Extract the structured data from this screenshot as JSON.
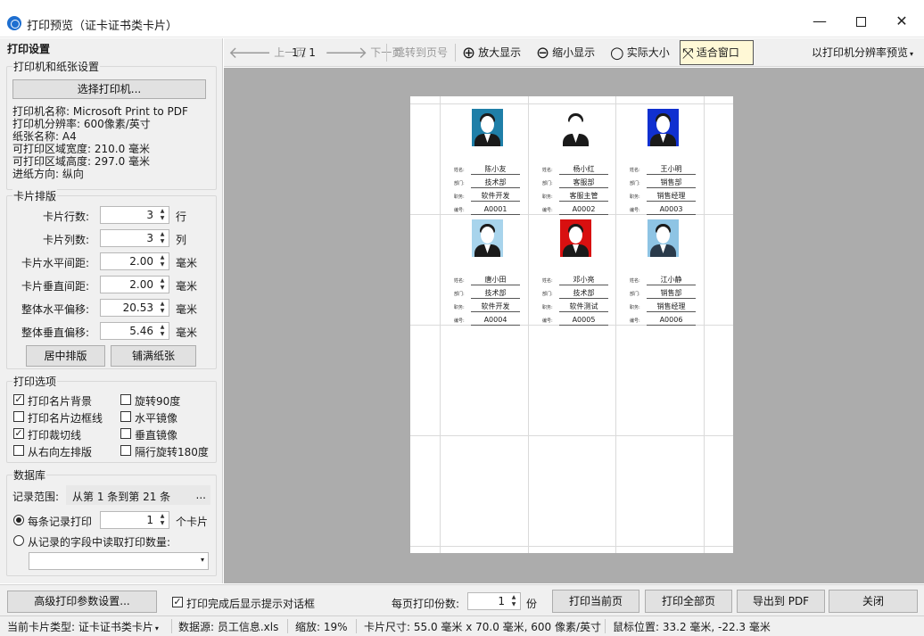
{
  "window": {
    "title": "打印预览（证卡证书类卡片）",
    "min_label": "—",
    "close_label": "✕"
  },
  "left_panel": {
    "title": "打印设置",
    "printer_group": {
      "title": "打印机和纸张设置",
      "select_printer_label": "选择打印机...",
      "lines": [
        "打印机名称: Microsoft Print to PDF",
        "打印机分辨率: 600像素/英寸",
        "纸张名称: A4",
        "可打印区域宽度: 210.0 毫米",
        "可打印区域高度: 297.0 毫米",
        "进纸方向: 纵向"
      ]
    },
    "layout_group": {
      "title": "卡片排版",
      "fields": [
        {
          "label": "卡片行数:",
          "value": "3",
          "unit": "行"
        },
        {
          "label": "卡片列数:",
          "value": "3",
          "unit": "列"
        },
        {
          "label": "卡片水平间距:",
          "value": "2.00",
          "unit": "毫米"
        },
        {
          "label": "卡片垂直间距:",
          "value": "2.00",
          "unit": "毫米"
        },
        {
          "label": "整体水平偏移:",
          "value": "20.53",
          "unit": "毫米"
        },
        {
          "label": "整体垂直偏移:",
          "value": "5.46",
          "unit": "毫米"
        }
      ],
      "center_label": "居中排版",
      "fill_label": "铺满纸张"
    },
    "options_group": {
      "title": "打印选项",
      "checkboxes": [
        {
          "label": "打印名片背景",
          "checked": true
        },
        {
          "label": "打印名片边框线",
          "checked": false
        },
        {
          "label": "打印裁切线",
          "checked": true
        },
        {
          "label": "从右向左排版",
          "checked": false
        },
        {
          "label": "旋转90度",
          "checked": false
        },
        {
          "label": "水平镜像",
          "checked": false
        },
        {
          "label": "垂直镜像",
          "checked": false
        },
        {
          "label": "隔行旋转180度",
          "checked": false
        }
      ],
      "check_mark": "✓"
    },
    "db_group": {
      "title": "数据库",
      "range_label": "记录范围:",
      "range_value": "从第 1 条到第 21 条",
      "range_button": "...",
      "per_record_label": "每条记录打印",
      "per_record_value": "1",
      "per_record_unit": "个卡片",
      "from_field_label": "从记录的字段中读取打印数量:",
      "field_select_value": ""
    }
  },
  "toolbar": {
    "prev_icon": "arrow-left-icon",
    "prev_label": "上一页",
    "page_indicator": "1 / 1",
    "next_icon": "arrow-right-icon",
    "next_label": "下一页",
    "jump_label": "跳转到页号",
    "zoom_in_label": "放大显示",
    "zoom_out_label": "缩小显示",
    "actual_label": "实际大小",
    "fit_label": "适合窗口",
    "resolution_label": "以打印机分辨率预览",
    "glyph_prev": "🡐",
    "glyph_next": "🡒",
    "glyph_zoom_in": "⊕",
    "glyph_zoom_out": "⊖",
    "glyph_actual": "○",
    "glyph_fit": "⤧",
    "glyph_caret": "▾"
  },
  "cards": [
    {
      "name_key": "姓名:",
      "name": "陈小友",
      "dept_key": "部门:",
      "dept": "技术部",
      "title_key": "职务:",
      "title": "软件开发",
      "id_key": "编号:",
      "id": "A0001",
      "bg": "#1f7fa8",
      "shirt": "#1a1a1a"
    },
    {
      "name_key": "姓名:",
      "name": "杨小红",
      "dept_key": "部门:",
      "dept": "客服部",
      "title_key": "职务:",
      "title": "客服主管",
      "id_key": "编号:",
      "id": "A0002",
      "bg": "#ffffff",
      "shirt": "#1a1a1a"
    },
    {
      "name_key": "姓名:",
      "name": "王小明",
      "dept_key": "部门:",
      "dept": "销售部",
      "title_key": "职务:",
      "title": "销售经理",
      "id_key": "编号:",
      "id": "A0003",
      "bg": "#1030d0",
      "shirt": "#1a1a1a"
    },
    {
      "name_key": "姓名:",
      "name": "唐小田",
      "dept_key": "部门:",
      "dept": "技术部",
      "title_key": "职务:",
      "title": "软件开发",
      "id_key": "编号:",
      "id": "A0004",
      "bg": "#a8d4ec",
      "shirt": "#1a1a1a"
    },
    {
      "name_key": "姓名:",
      "name": "邓小亮",
      "dept_key": "部门:",
      "dept": "技术部",
      "title_key": "职务:",
      "title": "软件测试",
      "id_key": "编号:",
      "id": "A0005",
      "bg": "#d81010",
      "shirt": "#1a1a1a"
    },
    {
      "name_key": "姓名:",
      "name": "江小静",
      "dept_key": "部门:",
      "dept": "销售部",
      "title_key": "职务:",
      "title": "销售经理",
      "id_key": "编号:",
      "id": "A0006",
      "bg": "#8ec4e4",
      "shirt": "#2a3a4a"
    }
  ],
  "bottom": {
    "advanced_label": "高级打印参数设置...",
    "show_dialog_label": "打印完成后显示提示对话框",
    "show_dialog_checked": true,
    "copies_label": "每页打印份数:",
    "copies_value": "1",
    "copies_unit": "份",
    "print_current_label": "打印当前页",
    "print_all_label": "打印全部页",
    "export_pdf_label": "导出到 PDF",
    "close_label": "关闭"
  },
  "status": {
    "card_type": "当前卡片类型: 证卡证书类卡片",
    "datasource": "数据源: 员工信息.xls",
    "zoom": "缩放: 19%",
    "card_size": "卡片尺寸: 55.0 毫米 x 70.0 毫米, 600 像素/英寸",
    "mouse_pos": "鼠标位置: 33.2 毫米, -22.3 毫米"
  }
}
